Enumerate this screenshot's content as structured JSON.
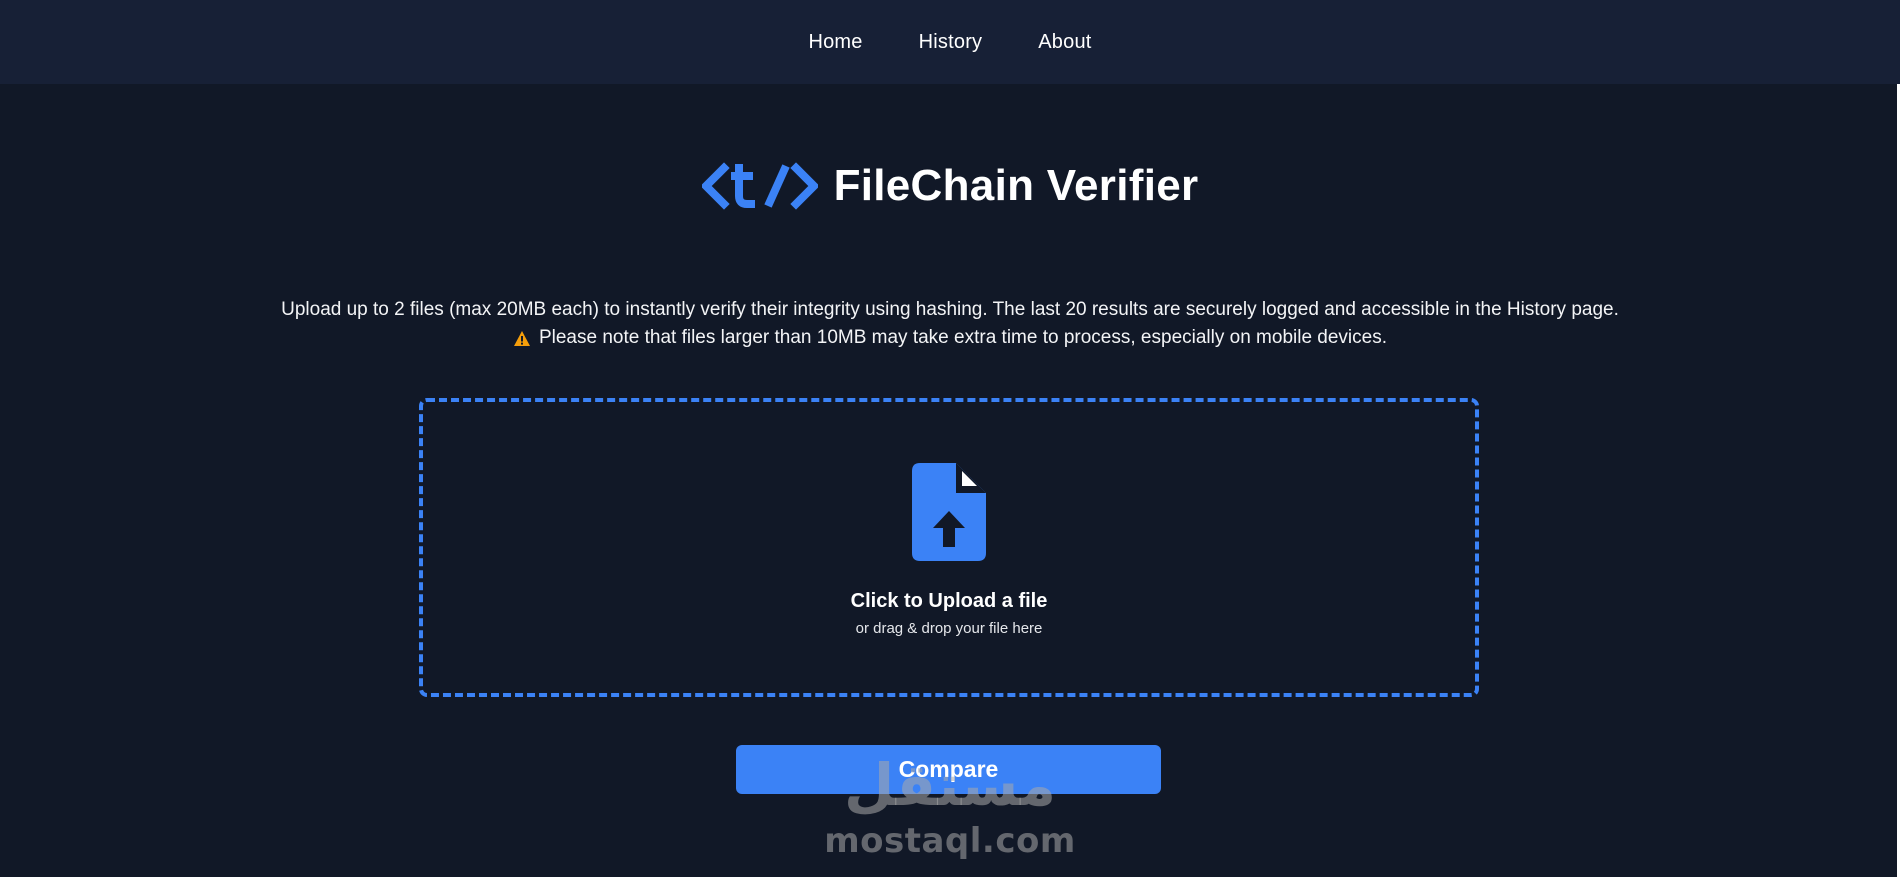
{
  "nav": {
    "items": [
      {
        "label": "Home"
      },
      {
        "label": "History"
      },
      {
        "label": "About"
      }
    ]
  },
  "header": {
    "logo_icon": "code-slash-logo-icon",
    "title": "FileChain Verifier"
  },
  "description": {
    "line1": "Upload up to 2 files (max 20MB each) to instantly verify their integrity using hashing. The last 20 results are securely logged and accessible in the History page.",
    "warning_icon": "warning-icon",
    "line2": "Please note that files larger than 10MB may take extra time to process, especially on mobile devices."
  },
  "dropzone": {
    "icon": "file-upload-icon",
    "title": "Click to Upload a file",
    "subtitle": "or drag & drop your file here"
  },
  "actions": {
    "compare_label": "Compare"
  },
  "watermark": {
    "arabic": "مستقل",
    "latin": "mostaql.com"
  },
  "colors": {
    "background": "#111827",
    "navbar": "#172036",
    "accent": "#3b82f6",
    "warning": "#f59e0b"
  }
}
